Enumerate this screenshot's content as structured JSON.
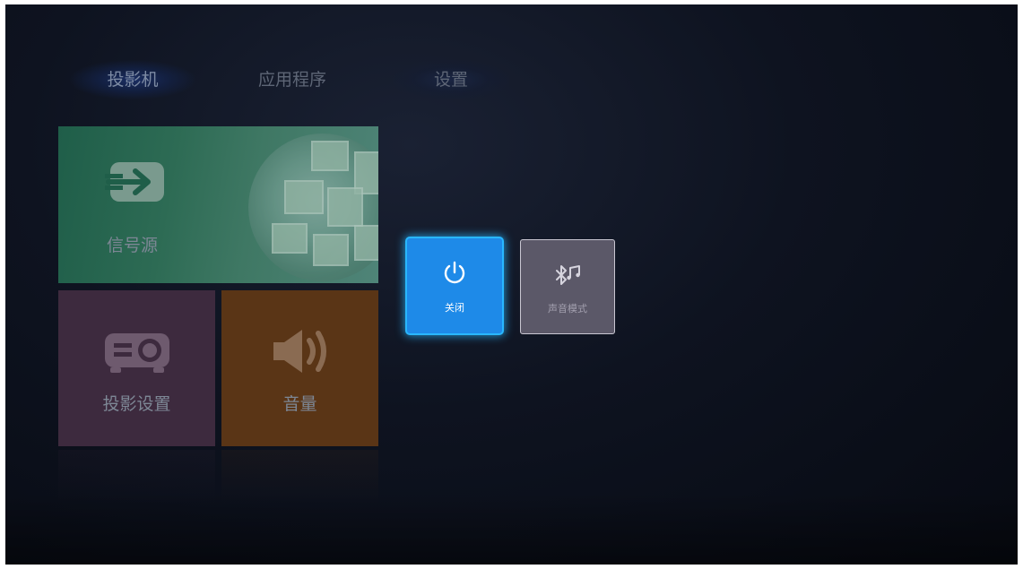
{
  "tabs": [
    {
      "label": "投影机"
    },
    {
      "label": "应用程序"
    },
    {
      "label": "设置"
    }
  ],
  "tiles": {
    "source": {
      "label": "信号源",
      "icon": "input-arrow-icon"
    },
    "projection_settings": {
      "label": "投影设置",
      "icon": "projector-icon"
    },
    "volume": {
      "label": "音量",
      "icon": "speaker-icon"
    }
  },
  "popup": {
    "power": {
      "label": "关闭",
      "icon": "power-icon"
    },
    "sound_mode": {
      "label": "声音模式",
      "icon": "bluetooth-music-icon"
    }
  },
  "colors": {
    "accent": "#1e8ae8",
    "focus_glow": "#29b7ff",
    "source_tile": "#2d6b54",
    "projection_tile": "#3d2a3e",
    "volume_tile": "#5a3516"
  }
}
